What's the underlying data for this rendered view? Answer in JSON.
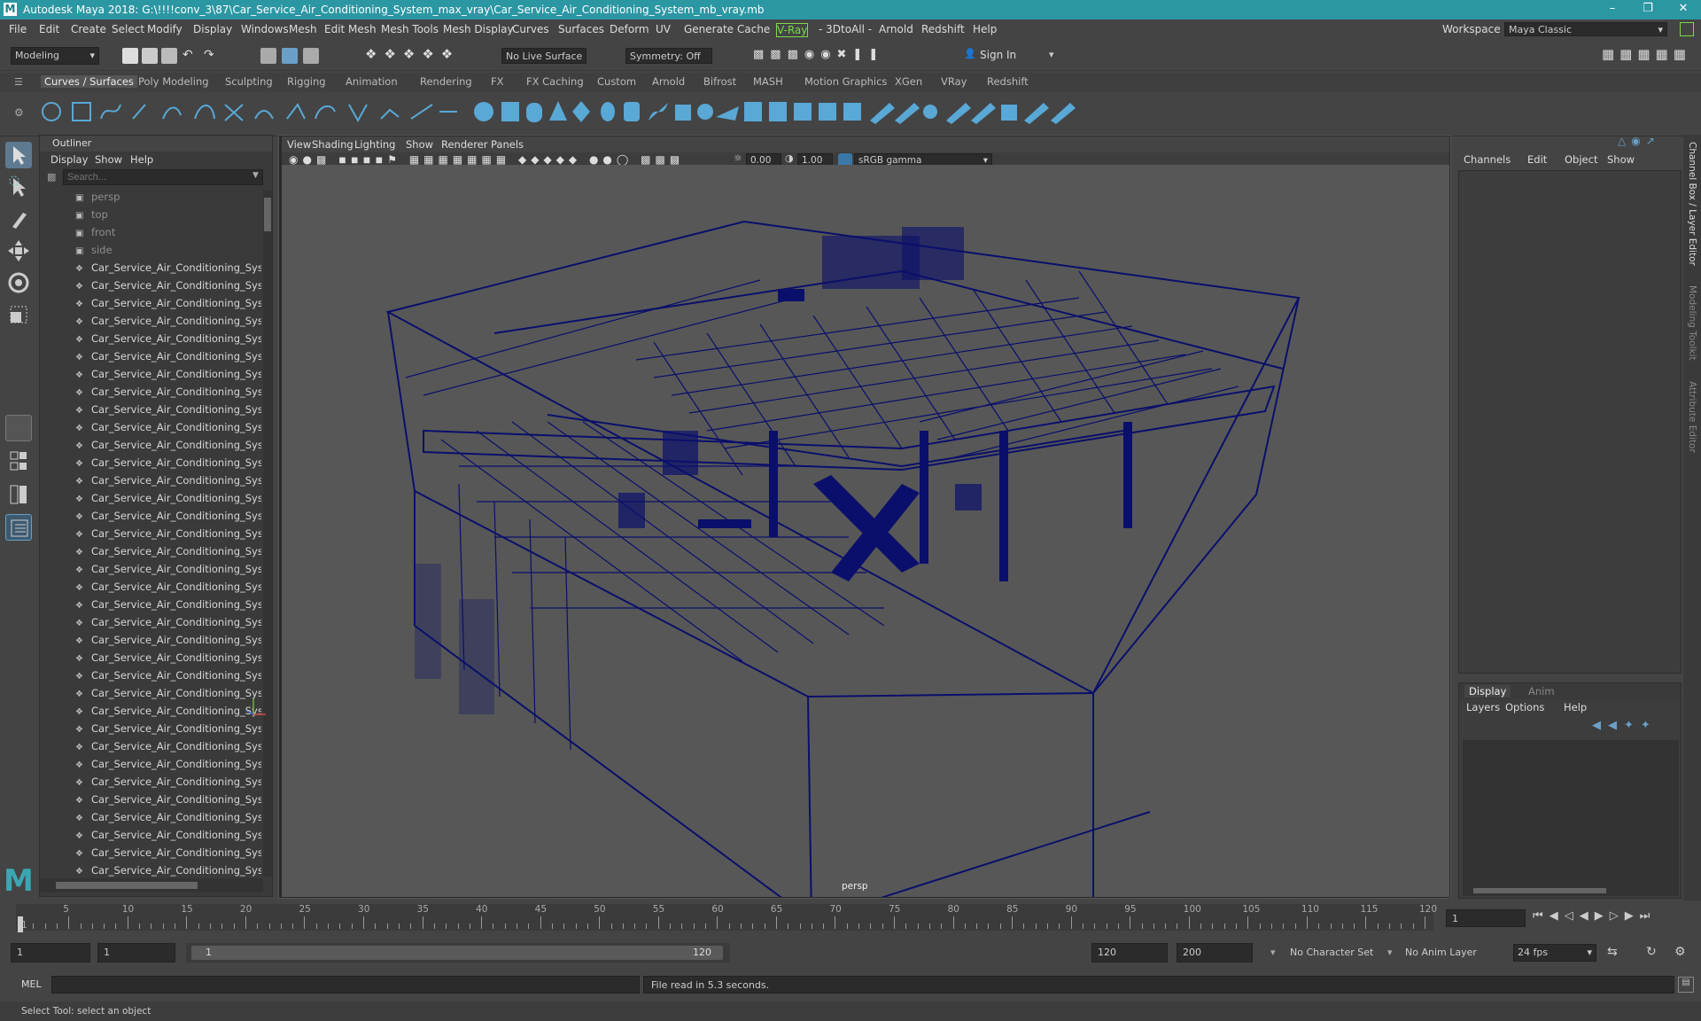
{
  "title": "Autodesk Maya 2018: G:\\!!!!conv_3\\87\\Car_Service_Air_Conditioning_System_max_vray\\Car_Service_Air_Conditioning_System_mb_vray.mb",
  "menu": [
    "File",
    "Edit",
    "Create",
    "Select",
    "Modify",
    "Display",
    "Windows",
    "Mesh",
    "Edit Mesh",
    "Mesh Tools",
    "Mesh Display",
    "Curves",
    "Surfaces",
    "Deform",
    "UV",
    "Generate",
    "Cache",
    "V-Ray",
    "- 3DtoAll -",
    "Arnold",
    "Redshift",
    "Help"
  ],
  "workspace": {
    "label": "Workspace :",
    "value": "Maya Classic"
  },
  "status": {
    "mode": "Modeling",
    "live_surface": "No Live Surface",
    "symmetry": "Symmetry: Off",
    "sign_in": "Sign In"
  },
  "shelf_tabs": [
    "Curves / Surfaces",
    "Poly Modeling",
    "Sculpting",
    "Rigging",
    "Animation",
    "Rendering",
    "FX",
    "FX Caching",
    "Custom",
    "Arnold",
    "Bifrost",
    "MASH",
    "Motion Graphics",
    "XGen",
    "VRay",
    "Redshift"
  ],
  "outliner": {
    "title": "Outliner",
    "menu": [
      "Display",
      "Show",
      "Help"
    ],
    "search_placeholder": "Search...",
    "cameras": [
      "persp",
      "top",
      "front",
      "side"
    ],
    "item_label": "Car_Service_Air_Conditioning_System",
    "item_count": 35
  },
  "viewport": {
    "menu": [
      "View",
      "Shading",
      "Lighting",
      "Show",
      "Renderer",
      "Panels"
    ],
    "exposure": "0.00",
    "gamma": "1.00",
    "colorspace": "sRGB gamma",
    "camera_label": "persp"
  },
  "channelbox": {
    "menu": [
      "Channels",
      "Edit",
      "Object",
      "Show"
    ]
  },
  "layers": {
    "tabs": [
      "Display",
      "Anim"
    ],
    "menu": [
      "Layers",
      "Options",
      "Help"
    ]
  },
  "side_tabs": [
    "Channel Box / Layer Editor",
    "Modeling Toolkit",
    "Attribute Editor"
  ],
  "timeline": {
    "ticks": [
      "5",
      "10",
      "15",
      "20",
      "25",
      "30",
      "35",
      "40",
      "45",
      "50",
      "55",
      "60",
      "65",
      "70",
      "75",
      "80",
      "85",
      "90",
      "95",
      "100",
      "105",
      "110",
      "115",
      "120"
    ],
    "start_label": "1",
    "current_frame": "1"
  },
  "range": {
    "start": "1",
    "start2": "1",
    "slider_start": "1",
    "slider_end": "120",
    "end": "120",
    "end2": "200",
    "character_set": "No Character Set",
    "anim_layer": "No Anim Layer",
    "fps": "24 fps"
  },
  "cmdline": {
    "lang": "MEL",
    "result": "File read in  5.3 seconds."
  },
  "helpline": "Select Tool: select an object",
  "colors": {
    "accent": "#2b97a3",
    "wire": "#0a0f6b",
    "vray": "#7cd84b"
  }
}
